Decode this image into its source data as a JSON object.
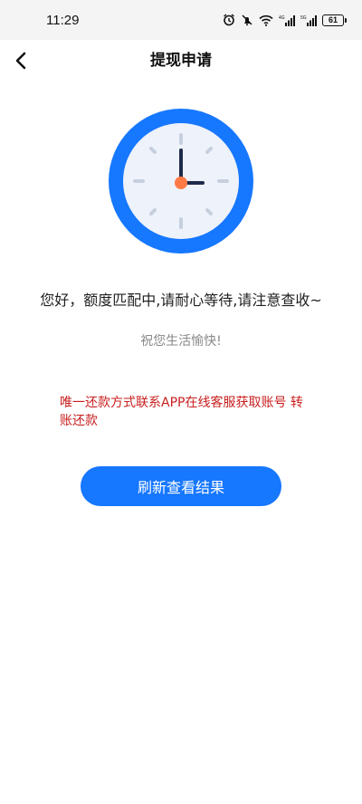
{
  "status_bar": {
    "time": "11:29",
    "battery": "61",
    "icons": [
      "alarm-icon",
      "mute-icon",
      "wifi-icon",
      "signal-4g-icon",
      "signal-5g-icon",
      "battery-icon"
    ]
  },
  "header": {
    "title": "提现申请",
    "back_icon": "back-arrow-icon"
  },
  "main": {
    "illustration": "clock-icon",
    "message": "您好，额度匹配中,请耐心等待,请注意查收~",
    "sub_message": "祝您生活愉快!",
    "notice": "唯一还款方式联系APP在线客服获取账号  转账还款",
    "refresh_button": "刷新查看结果"
  },
  "colors": {
    "accent": "#1677ff",
    "notice": "#c81e1e",
    "clock_face": "#eef2fa",
    "clock_hand": "#1e2a4a",
    "clock_center": "#ff7a45"
  }
}
